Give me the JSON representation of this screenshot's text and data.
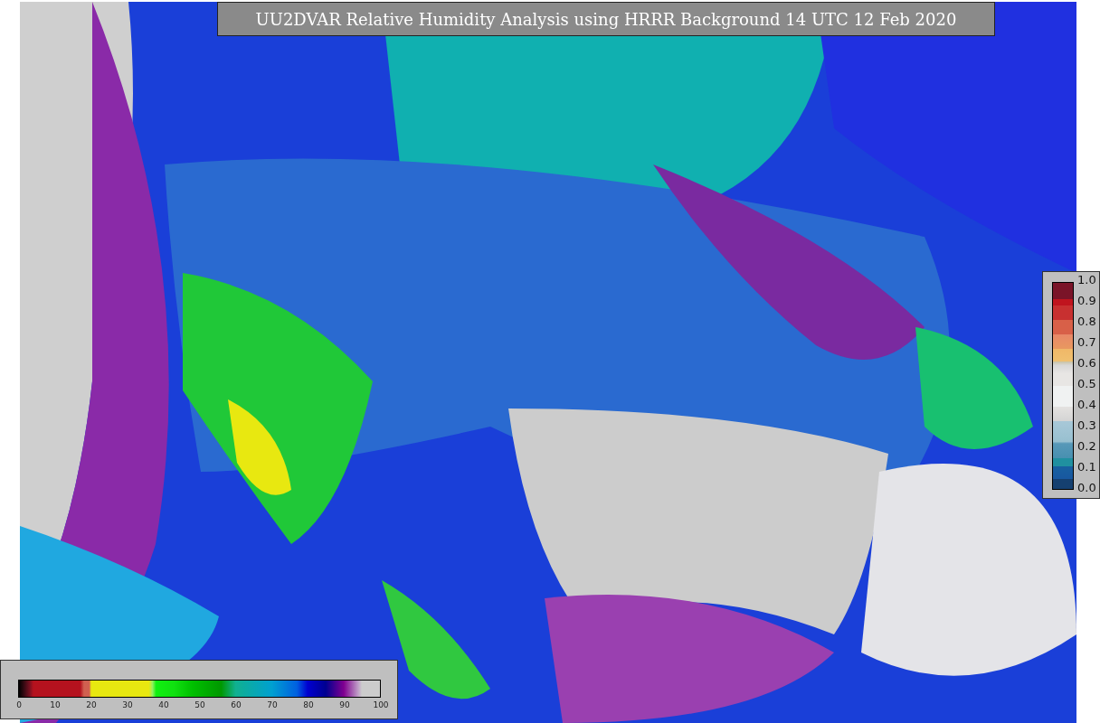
{
  "title": "UU2DVAR Relative Humidity Analysis using HRRR Background 14 UTC 12 Feb 2020",
  "analysis_colorbar": {
    "ticks": [
      "0",
      "10",
      "20",
      "30",
      "40",
      "50",
      "60",
      "70",
      "80",
      "90",
      "100"
    ]
  },
  "observation_colorbar": {
    "ticks": [
      "1.0",
      "0.9",
      "0.8",
      "0.7",
      "0.6",
      "0.5",
      "0.4",
      "0.3",
      "0.2",
      "0.1",
      "0.0"
    ]
  }
}
